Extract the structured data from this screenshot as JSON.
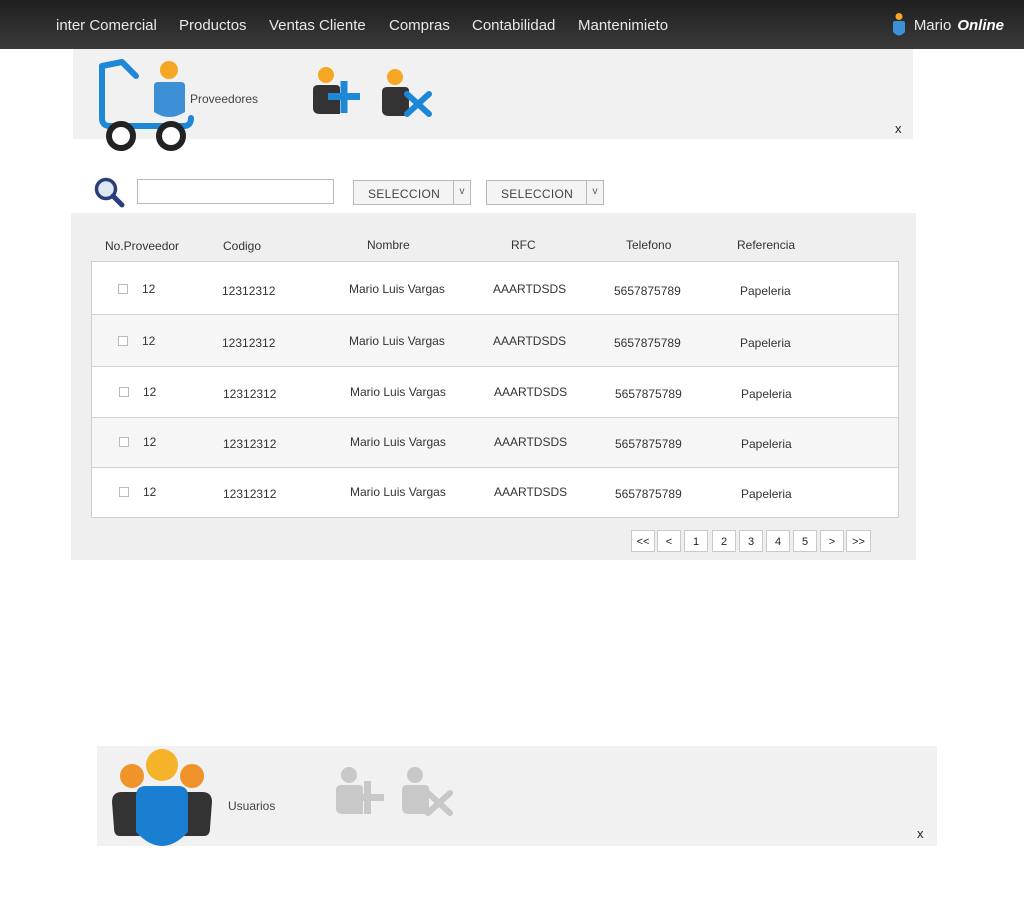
{
  "nav": {
    "items": [
      "inter Comercial",
      "Productos",
      "Ventas Cliente",
      "Compras",
      "Contabilidad",
      "Mantenimieto"
    ],
    "user_name": "Mario",
    "user_status": "Online"
  },
  "proveedores": {
    "label": "Proveedores",
    "close": "x",
    "search": {
      "value": "",
      "placeholder": ""
    },
    "select1": "SELECCION",
    "select2": "SELECCION",
    "select_arrow": "v",
    "columns": [
      "No.Proveedor",
      "Codigo",
      "Nombre",
      "RFC",
      "Telefono",
      "Referencia"
    ],
    "rows": [
      {
        "no": "12",
        "codigo": "12312312",
        "nombre": "Mario Luis Vargas",
        "rfc": "AAARTDSDS",
        "telefono": "5657875789",
        "referencia": "Papeleria"
      },
      {
        "no": "12",
        "codigo": "12312312",
        "nombre": "Mario Luis Vargas",
        "rfc": "AAARTDSDS",
        "telefono": "5657875789",
        "referencia": "Papeleria"
      },
      {
        "no": "12",
        "codigo": "12312312",
        "nombre": "Mario Luis Vargas",
        "rfc": "AAARTDSDS",
        "telefono": "5657875789",
        "referencia": "Papeleria"
      },
      {
        "no": "12",
        "codigo": "12312312",
        "nombre": "Mario Luis Vargas",
        "rfc": "AAARTDSDS",
        "telefono": "5657875789",
        "referencia": "Papeleria"
      },
      {
        "no": "12",
        "codigo": "12312312",
        "nombre": "Mario Luis Vargas",
        "rfc": "AAARTDSDS",
        "telefono": "5657875789",
        "referencia": "Papeleria"
      }
    ],
    "pager": [
      "<<",
      "<",
      "1",
      "2",
      "3",
      "4",
      "5",
      ">",
      ">>"
    ]
  },
  "usuarios": {
    "label": "Usuarios",
    "close": "x"
  },
  "colors": {
    "nav_bg": "#2a2a2a",
    "accent_blue": "#1e88d6",
    "accent_orange": "#f5a623",
    "icon_dark": "#333333",
    "panel_bg": "#f1f1f1"
  },
  "icons": {
    "proveedores": "cart-person-icon",
    "add_user": "add-user-icon",
    "remove_user": "remove-user-icon",
    "search": "search-icon",
    "user_status": "user-status-icon",
    "usuarios": "users-group-icon"
  }
}
